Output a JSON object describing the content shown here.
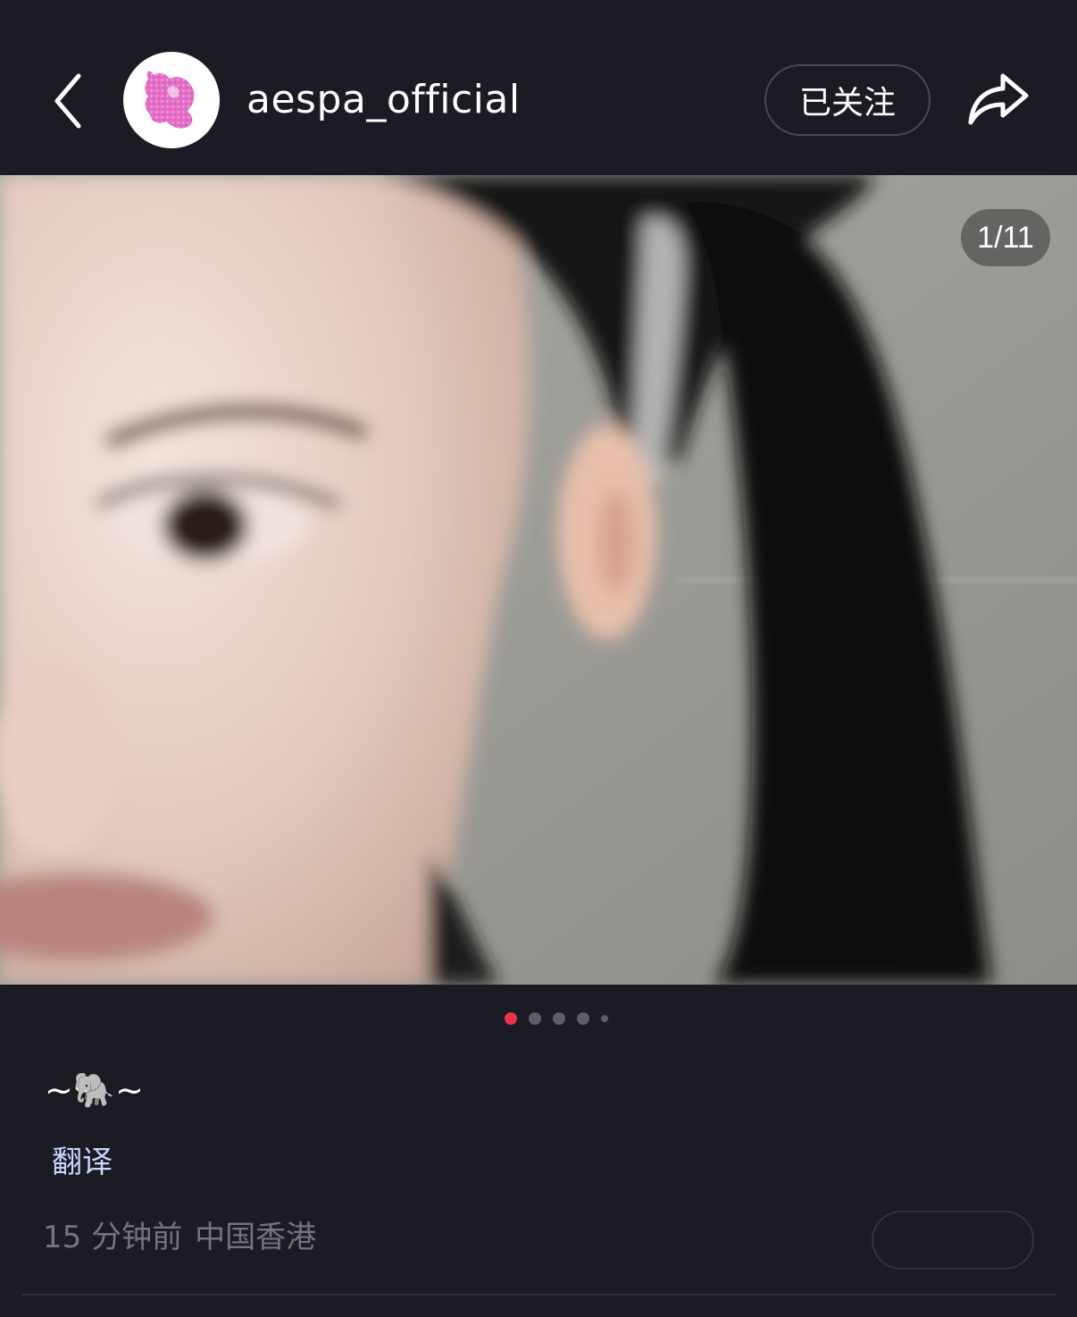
{
  "header": {
    "username": "aespa_official",
    "follow_label": "已关注"
  },
  "photo": {
    "counter": "1/11",
    "current_index": 1,
    "total": 11
  },
  "pagination": {
    "dots": 5,
    "active": 0
  },
  "post": {
    "caption": "~🐘~",
    "translate_label": "翻译",
    "time": "15 分钟前",
    "location": "中国香港"
  },
  "colors": {
    "background": "#1c1b24",
    "active_dot": "#e8334a",
    "translate_link": "#c9d8ff",
    "meta_text": "#74737e"
  },
  "icons": [
    "back-icon",
    "avatar-logo",
    "share-icon"
  ]
}
